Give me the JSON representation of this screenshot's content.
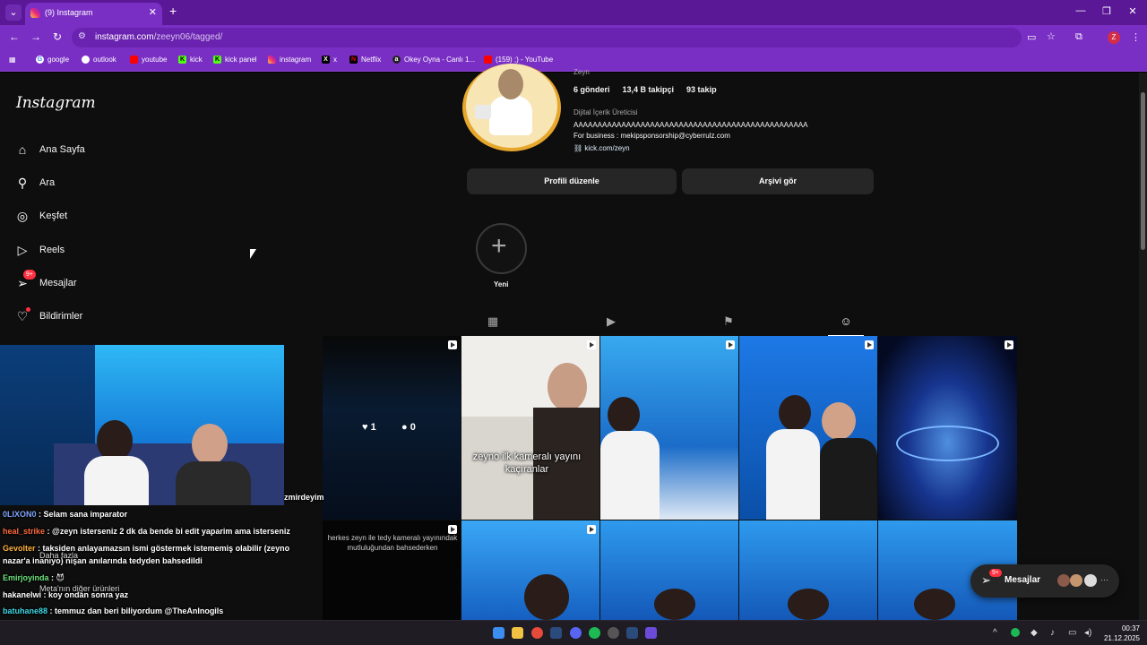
{
  "browser": {
    "tab_title": "(9) Instagram",
    "url_host": "instagram.com",
    "url_path": "/zeeyn06/tagged/",
    "bookmarks": [
      "google",
      "outlook",
      "youtube",
      "kick",
      "kick panel",
      "instagram",
      "x",
      "Netflix",
      "Okey Oyna - Canlı 1...",
      "(159) ;) - YouTube"
    ]
  },
  "sidebar": {
    "logo": "Instagram",
    "items": [
      {
        "label": "Ana Sayfa",
        "icon": "home-icon"
      },
      {
        "label": "Ara",
        "icon": "search-icon"
      },
      {
        "label": "Keşfet",
        "icon": "compass-icon"
      },
      {
        "label": "Reels",
        "icon": "reels-icon"
      },
      {
        "label": "Mesajlar",
        "icon": "messenger-icon",
        "badge": "9+"
      },
      {
        "label": "Bildirimler",
        "icon": "heart-icon"
      }
    ],
    "more": "Daha fazla",
    "meta": "Meta'nın diğer ürünleri"
  },
  "profile": {
    "name": "Zeyn",
    "posts": "6 gönderi",
    "followers": "13,4 B takipçi",
    "following": "93 takip",
    "category": "Dijital İçerik Üreticisi",
    "bio_line": "AAAAAAAAAAAAAAAAAAAAAAAAAAAAAAAAAAAAAAAAAAAAAAAAA",
    "business": "For business : mekipsponsorship@cyberrulz.com",
    "link": "kick.com/zeyn",
    "edit_button": "Profili düzenle",
    "archive_button": "Arşivi gör",
    "new_story": "Yeni"
  },
  "grid": {
    "hover_likes": "1",
    "hover_comments": "0",
    "caption_kamera": "zeyno ilk kameralı yayını kaçıranlar",
    "caption_herkes": "herkes zeyn ile tedy kameralı yayınındak mutluluğundan bahsederken"
  },
  "floating_messages": {
    "label": "Mesajlar",
    "badge": "9+"
  },
  "stream_chat": {
    "cut_text": "zmirdeyim",
    "lines": [
      {
        "user": "0LIXON0",
        "color": "#7fa4ff",
        "text": ": Selam sana imparator"
      },
      {
        "user": "heal_strike",
        "color": "#ff6a3d",
        "text": ": @zeyn isterseniz 2 dk da bende bi edit yaparim ama isterseniz"
      },
      {
        "user": "Gevolter",
        "color": "#ffb23d",
        "text": ": taksiden anlayamazsın ismi göstermek istememiş olabilir (zeyno"
      },
      {
        "user": "",
        "color": "#ffffff",
        "text": "nazar'a inanıyo) nişan anılarında tedyden bahsedildi"
      },
      {
        "user": "Emirjoyinda",
        "color": "#6de37d",
        "text": ": 😈"
      },
      {
        "user": "hakanelwi",
        "color": "#ffffff",
        "text": ": koy ondan sonra yaz"
      },
      {
        "user": "batuhane88",
        "color": "#3fd8e8",
        "text": ": temmuz dan beri biliyordum @TheAnInogils"
      }
    ]
  },
  "taskbar": {
    "time": "00:37",
    "date": "21.12.2025"
  },
  "colors": {
    "browser_tab": "#5b1896",
    "browser_bar": "#7a2fc4",
    "ig_bg": "#0e0e0e",
    "badge": "#ff3040"
  }
}
